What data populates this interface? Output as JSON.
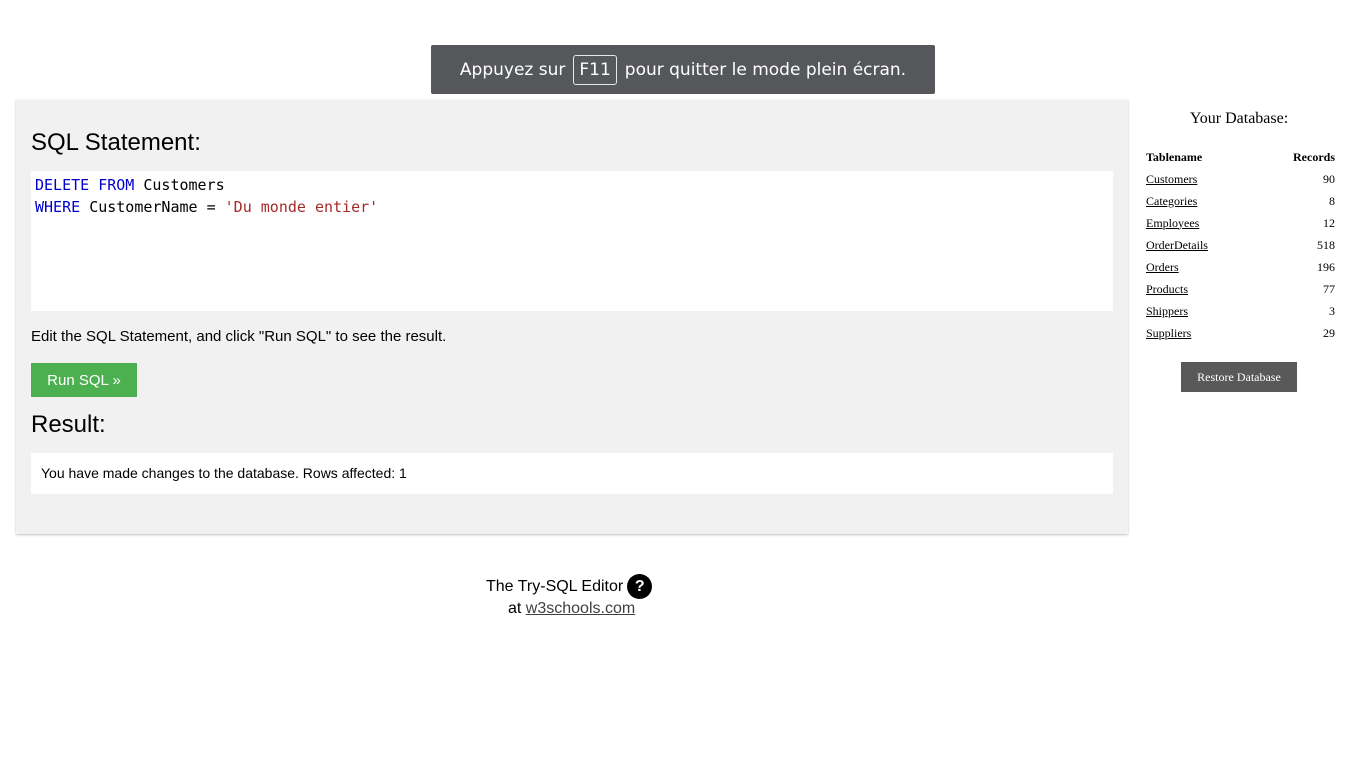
{
  "fullscreen_notice": {
    "before": "Appuyez sur",
    "key": "F11",
    "after": "pour quitter le mode plein écran."
  },
  "editor": {
    "statement_title": "SQL Statement:",
    "code": {
      "line1": {
        "kw1": "DELETE",
        "kw2": "FROM",
        "table": "Customers"
      },
      "line2": {
        "kw": "WHERE",
        "column": "CustomerName",
        "op": "=",
        "value": "'Du monde entier'"
      }
    },
    "hint": "Edit the SQL Statement, and click \"Run SQL\" to see the result.",
    "run_label": "Run SQL »",
    "result_title": "Result:",
    "result_text": "You have made changes to the database. Rows affected: 1"
  },
  "footer": {
    "line1": "The Try-SQL Editor",
    "help_glyph": "?",
    "line2_prefix": "at",
    "link": "w3schools.com"
  },
  "database": {
    "title": "Your Database:",
    "headers": {
      "name": "Tablename",
      "records": "Records"
    },
    "tables": [
      {
        "name": "Customers",
        "records": "90"
      },
      {
        "name": "Categories",
        "records": "8"
      },
      {
        "name": "Employees",
        "records": "12"
      },
      {
        "name": "OrderDetails",
        "records": "518"
      },
      {
        "name": "Orders",
        "records": "196"
      },
      {
        "name": "Products",
        "records": "77"
      },
      {
        "name": "Shippers",
        "records": "3"
      },
      {
        "name": "Suppliers",
        "records": "29"
      }
    ],
    "restore_label": "Restore Database"
  },
  "colors": {
    "run_button": "#4caf50",
    "keyword": "#0000cd",
    "string": "#a52a2a",
    "panel": "#f1f1f1",
    "restore_button": "#595959"
  },
  "icons": {
    "help": "help-circle-icon"
  }
}
